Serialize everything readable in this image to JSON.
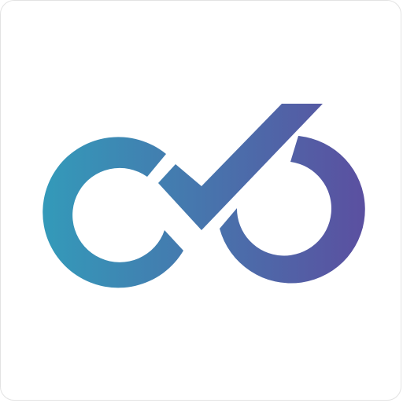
{
  "icon": {
    "name": "infinity-checkmark-logo",
    "background_color": "#ffffff",
    "border_color": "#e3e3e3",
    "gradient_start_color": "#3499b9",
    "gradient_end_color": "#5b4fa0"
  }
}
